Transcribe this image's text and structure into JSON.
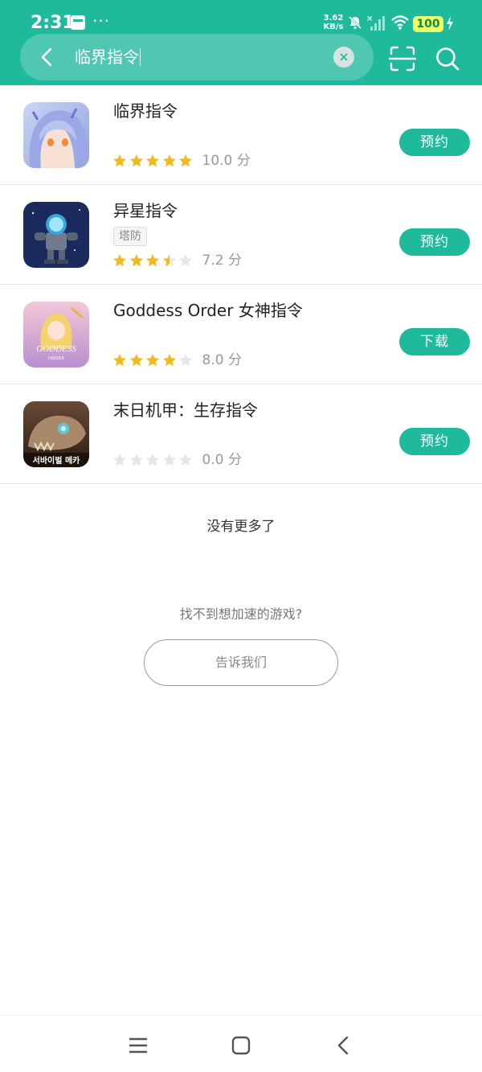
{
  "status_bar": {
    "time": "2:31",
    "more": "···",
    "net_speed_value": "3.62",
    "net_speed_unit": "KB/s",
    "battery": "100"
  },
  "search": {
    "query": "临界指令",
    "clear_icon": "close-circle-icon"
  },
  "games": [
    {
      "name": "临界指令",
      "tag": "",
      "rating": 5,
      "score": "10.0 分",
      "action": "预约",
      "icon": "anime-girl-icon"
    },
    {
      "name": "异星指令",
      "tag": "塔防",
      "rating": 3.5,
      "score": "7.2 分",
      "action": "预约",
      "icon": "robot-mech-icon"
    },
    {
      "name": "Goddess Order 女神指令",
      "tag": "",
      "rating": 4,
      "score": "8.0 分",
      "action": "下载",
      "icon": "goddess-order-icon",
      "icon_text_1": "GODDESS",
      "icon_text_2": "ORDER"
    },
    {
      "name": "末日机甲：生存指令",
      "tag": "",
      "rating": 0,
      "score": "0.0 分",
      "action": "预约",
      "icon": "dinosaur-skull-icon",
      "icon_text_1": "서바이벌 메카"
    }
  ],
  "footer": {
    "no_more": "没有更多了",
    "cant_find": "找不到想加速的游戏?",
    "tell_us": "告诉我们"
  },
  "colors": {
    "accent": "#1fb99b",
    "star_on": "#f5b91e",
    "star_off": "#e6e6e6"
  }
}
